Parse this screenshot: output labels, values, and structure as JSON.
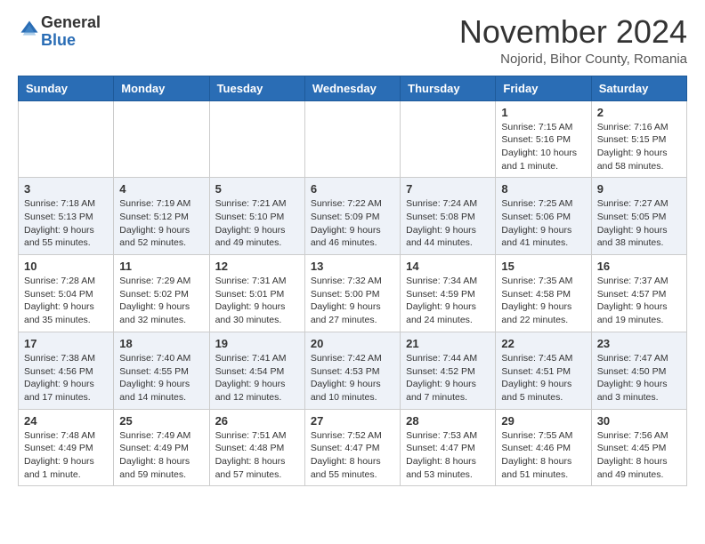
{
  "header": {
    "logo": {
      "general": "General",
      "blue": "Blue"
    },
    "title": "November 2024",
    "location": "Nojorid, Bihor County, Romania"
  },
  "calendar": {
    "weekdays": [
      "Sunday",
      "Monday",
      "Tuesday",
      "Wednesday",
      "Thursday",
      "Friday",
      "Saturday"
    ],
    "weeks": [
      [
        {
          "day": "",
          "info": ""
        },
        {
          "day": "",
          "info": ""
        },
        {
          "day": "",
          "info": ""
        },
        {
          "day": "",
          "info": ""
        },
        {
          "day": "",
          "info": ""
        },
        {
          "day": "1",
          "info": "Sunrise: 7:15 AM\nSunset: 5:16 PM\nDaylight: 10 hours and 1 minute."
        },
        {
          "day": "2",
          "info": "Sunrise: 7:16 AM\nSunset: 5:15 PM\nDaylight: 9 hours and 58 minutes."
        }
      ],
      [
        {
          "day": "3",
          "info": "Sunrise: 7:18 AM\nSunset: 5:13 PM\nDaylight: 9 hours and 55 minutes."
        },
        {
          "day": "4",
          "info": "Sunrise: 7:19 AM\nSunset: 5:12 PM\nDaylight: 9 hours and 52 minutes."
        },
        {
          "day": "5",
          "info": "Sunrise: 7:21 AM\nSunset: 5:10 PM\nDaylight: 9 hours and 49 minutes."
        },
        {
          "day": "6",
          "info": "Sunrise: 7:22 AM\nSunset: 5:09 PM\nDaylight: 9 hours and 46 minutes."
        },
        {
          "day": "7",
          "info": "Sunrise: 7:24 AM\nSunset: 5:08 PM\nDaylight: 9 hours and 44 minutes."
        },
        {
          "day": "8",
          "info": "Sunrise: 7:25 AM\nSunset: 5:06 PM\nDaylight: 9 hours and 41 minutes."
        },
        {
          "day": "9",
          "info": "Sunrise: 7:27 AM\nSunset: 5:05 PM\nDaylight: 9 hours and 38 minutes."
        }
      ],
      [
        {
          "day": "10",
          "info": "Sunrise: 7:28 AM\nSunset: 5:04 PM\nDaylight: 9 hours and 35 minutes."
        },
        {
          "day": "11",
          "info": "Sunrise: 7:29 AM\nSunset: 5:02 PM\nDaylight: 9 hours and 32 minutes."
        },
        {
          "day": "12",
          "info": "Sunrise: 7:31 AM\nSunset: 5:01 PM\nDaylight: 9 hours and 30 minutes."
        },
        {
          "day": "13",
          "info": "Sunrise: 7:32 AM\nSunset: 5:00 PM\nDaylight: 9 hours and 27 minutes."
        },
        {
          "day": "14",
          "info": "Sunrise: 7:34 AM\nSunset: 4:59 PM\nDaylight: 9 hours and 24 minutes."
        },
        {
          "day": "15",
          "info": "Sunrise: 7:35 AM\nSunset: 4:58 PM\nDaylight: 9 hours and 22 minutes."
        },
        {
          "day": "16",
          "info": "Sunrise: 7:37 AM\nSunset: 4:57 PM\nDaylight: 9 hours and 19 minutes."
        }
      ],
      [
        {
          "day": "17",
          "info": "Sunrise: 7:38 AM\nSunset: 4:56 PM\nDaylight: 9 hours and 17 minutes."
        },
        {
          "day": "18",
          "info": "Sunrise: 7:40 AM\nSunset: 4:55 PM\nDaylight: 9 hours and 14 minutes."
        },
        {
          "day": "19",
          "info": "Sunrise: 7:41 AM\nSunset: 4:54 PM\nDaylight: 9 hours and 12 minutes."
        },
        {
          "day": "20",
          "info": "Sunrise: 7:42 AM\nSunset: 4:53 PM\nDaylight: 9 hours and 10 minutes."
        },
        {
          "day": "21",
          "info": "Sunrise: 7:44 AM\nSunset: 4:52 PM\nDaylight: 9 hours and 7 minutes."
        },
        {
          "day": "22",
          "info": "Sunrise: 7:45 AM\nSunset: 4:51 PM\nDaylight: 9 hours and 5 minutes."
        },
        {
          "day": "23",
          "info": "Sunrise: 7:47 AM\nSunset: 4:50 PM\nDaylight: 9 hours and 3 minutes."
        }
      ],
      [
        {
          "day": "24",
          "info": "Sunrise: 7:48 AM\nSunset: 4:49 PM\nDaylight: 9 hours and 1 minute."
        },
        {
          "day": "25",
          "info": "Sunrise: 7:49 AM\nSunset: 4:49 PM\nDaylight: 8 hours and 59 minutes."
        },
        {
          "day": "26",
          "info": "Sunrise: 7:51 AM\nSunset: 4:48 PM\nDaylight: 8 hours and 57 minutes."
        },
        {
          "day": "27",
          "info": "Sunrise: 7:52 AM\nSunset: 4:47 PM\nDaylight: 8 hours and 55 minutes."
        },
        {
          "day": "28",
          "info": "Sunrise: 7:53 AM\nSunset: 4:47 PM\nDaylight: 8 hours and 53 minutes."
        },
        {
          "day": "29",
          "info": "Sunrise: 7:55 AM\nSunset: 4:46 PM\nDaylight: 8 hours and 51 minutes."
        },
        {
          "day": "30",
          "info": "Sunrise: 7:56 AM\nSunset: 4:45 PM\nDaylight: 8 hours and 49 minutes."
        }
      ]
    ]
  }
}
